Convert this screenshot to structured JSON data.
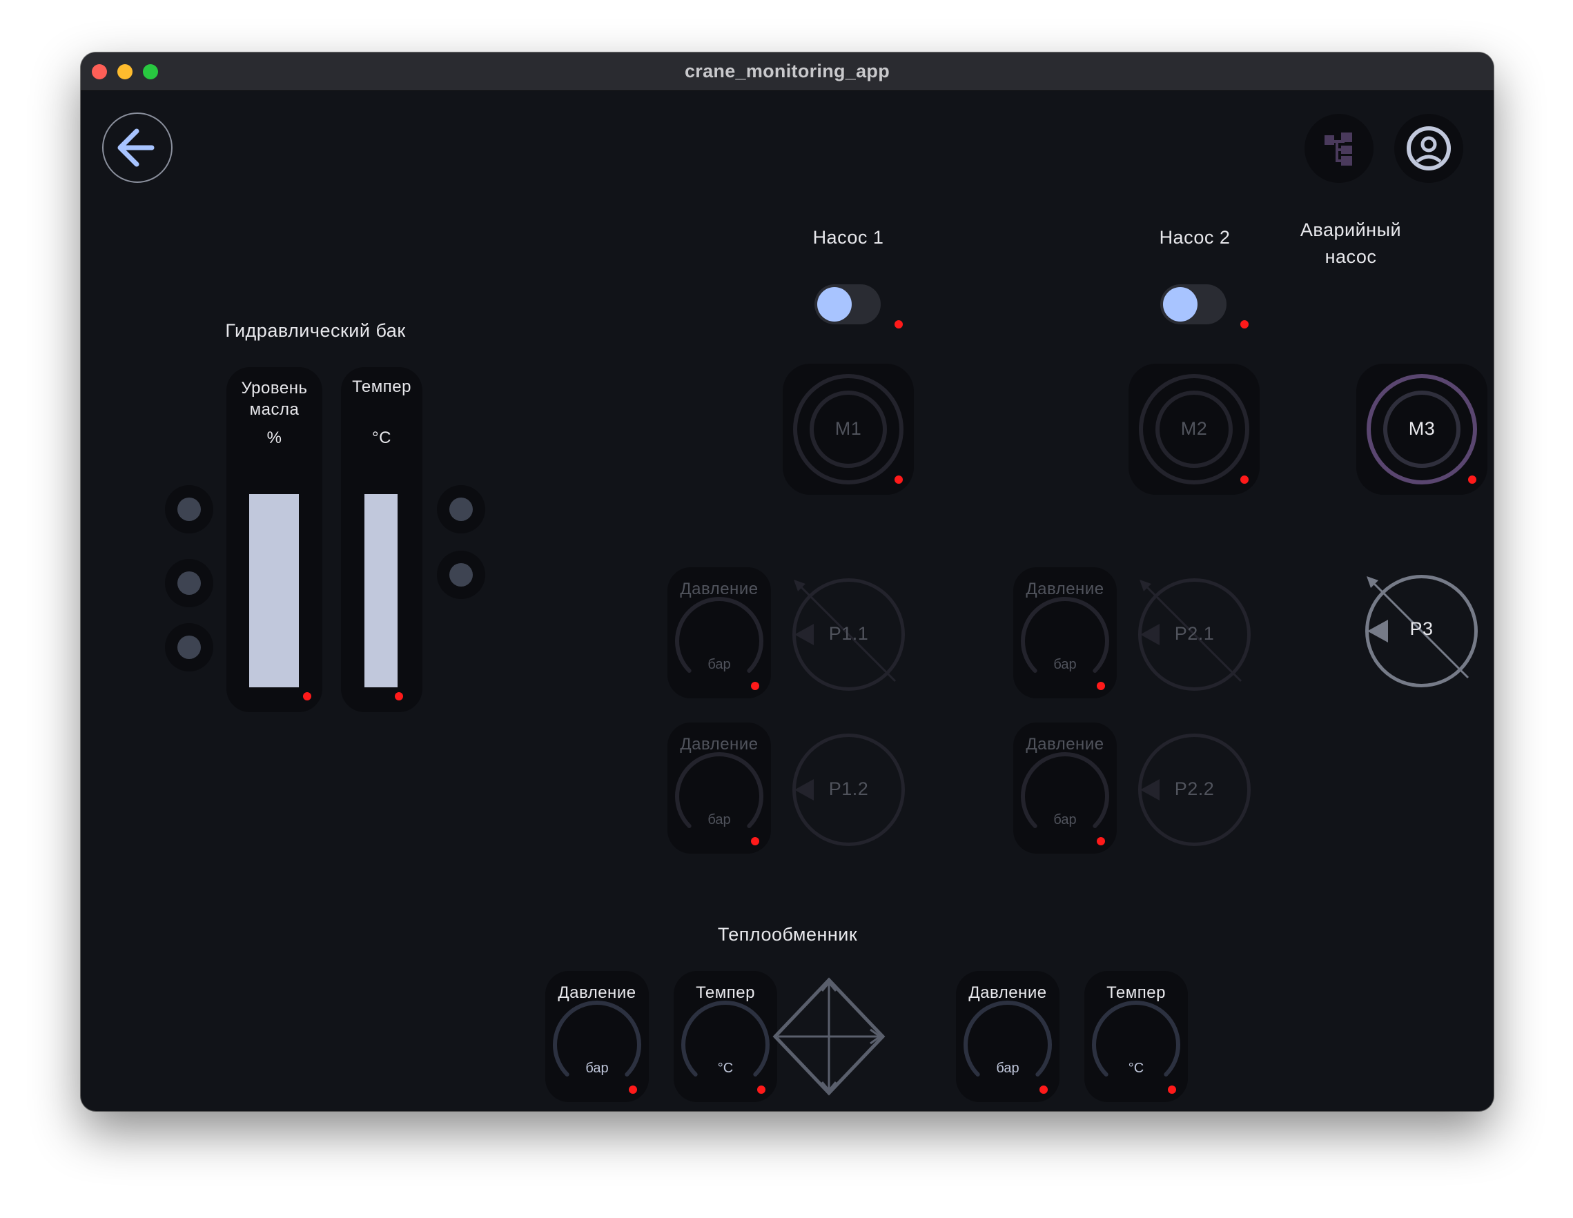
{
  "window": {
    "title": "crane_monitoring_app"
  },
  "icons": {
    "back": "arrow-left-icon",
    "structure": "hierarchy-icon",
    "account": "user-circle-icon"
  },
  "colors": {
    "background": "#111318",
    "tile": "#0b0c10",
    "accent": "#a8c4ff",
    "status_dot": "#ff1a1a",
    "motor_active": "#5a4670",
    "bar_fill": "#c1c8dc"
  },
  "tank": {
    "title": "Гидравлический бак",
    "oil_level": {
      "label": "Уровень масла",
      "unit": "%",
      "fill": 1.0
    },
    "temperature": {
      "label": "Темпер",
      "unit": "°C",
      "fill": 1.0
    }
  },
  "pumps": [
    {
      "title": "Насос 1",
      "toggle_on": true,
      "motor": "M1",
      "pressure": [
        {
          "label": "Давление",
          "unit": "бар"
        },
        {
          "label": "Давление",
          "unit": "бар"
        }
      ],
      "valves": [
        "P1.1",
        "P1.2"
      ]
    },
    {
      "title": "Насос 2",
      "toggle_on": true,
      "motor": "M2",
      "pressure": [
        {
          "label": "Давление",
          "unit": "бар"
        },
        {
          "label": "Давление",
          "unit": "бар"
        }
      ],
      "valves": [
        "P2.1",
        "P2.2"
      ]
    },
    {
      "title": "Аварийный насос",
      "motor": "M3",
      "valve": "P3"
    }
  ],
  "heat_exchanger": {
    "title": "Теплообменник",
    "gauges": [
      {
        "label": "Давление",
        "unit": "бар"
      },
      {
        "label": "Темпер",
        "unit": "°C"
      },
      {
        "label": "Давление",
        "unit": "бар"
      },
      {
        "label": "Темпер",
        "unit": "°C"
      }
    ]
  }
}
